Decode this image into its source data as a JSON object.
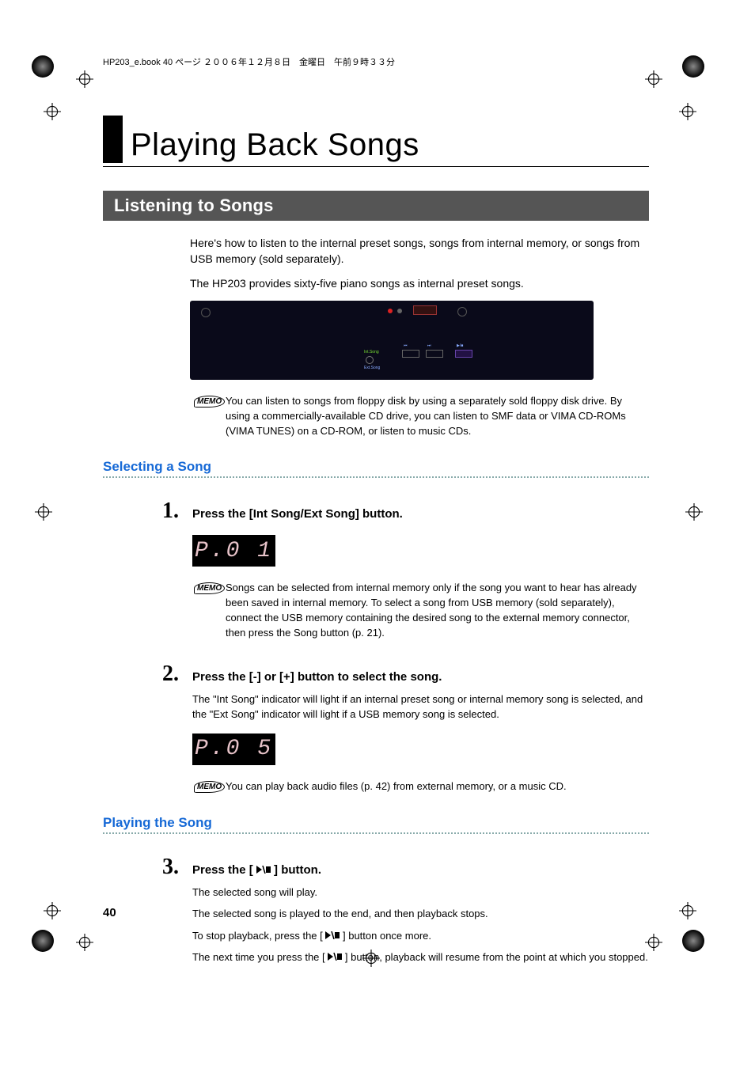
{
  "header_line": "HP203_e.book  40 ページ  ２００６年１２月８日　金曜日　午前９時３３分",
  "chapter_title": "Playing Back Songs",
  "section_title": "Listening to Songs",
  "intro_p1": "Here's how to listen to the internal preset songs, songs from internal memory, or songs from USB memory (sold separately).",
  "intro_p2": "The HP203 provides sixty-five piano songs as internal preset songs.",
  "memo_label": "MEMO",
  "memo1": "You can listen to songs from floppy disk by using a separately sold floppy disk drive. By using a commercially-available CD drive, you can listen to SMF data or VIMA CD-ROMs (VIMA TUNES) on a CD-ROM, or listen to music CDs.",
  "subhead1": "Selecting a Song",
  "step1_num": "1.",
  "step1_title": "Press the [Int Song/Ext Song] button.",
  "display1": "P.0 1",
  "memo2": "Songs can be selected from internal memory only if the song you want to hear has already been saved in internal memory. To select a song from USB memory (sold separately), connect the USB memory containing the desired song to the external memory connector, then press the Song button (p. 21).",
  "step2_num": "2.",
  "step2_title": "Press the [-] or [+] button to select the song.",
  "step2_body": "The \"Int Song\" indicator will light if an internal preset song or internal memory song is selected, and the \"Ext Song\" indicator will light if a USB memory song is selected.",
  "display2": "P.0 5",
  "memo3": "You can play back audio files (p. 42) from external memory, or a music CD.",
  "subhead2": "Playing the Song",
  "step3_num": "3.",
  "step3_title_a": "Press the [ ",
  "step3_title_b": " ] button.",
  "step3_body1": "The selected song will play.",
  "step3_body2": "The selected song is played to the end, and then playback stops.",
  "step3_body3a": "To stop playback, press the [ ",
  "step3_body3b": " ] button once more.",
  "step3_body4a": "The next time you press the [ ",
  "step3_body4b": " ] button, playback will resume from the point at which you stopped.",
  "page_number": "40",
  "panel": {
    "int_song": "Int.Song",
    "ext_song": "Ext.Song"
  }
}
